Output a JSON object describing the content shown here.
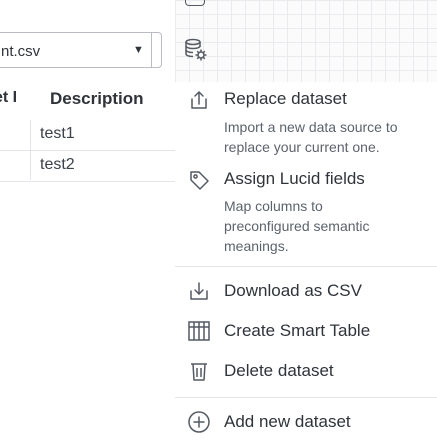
{
  "dataset_select": {
    "value": "nt.csv",
    "caret": "▼"
  },
  "table": {
    "partial_header": "et I",
    "description_header": "Description",
    "rows": [
      "test1",
      "test2"
    ]
  },
  "toolbar": {
    "icons": [
      "layout-icon",
      "database-settings-icon"
    ]
  },
  "menu": {
    "replace": {
      "label": "Replace dataset",
      "description": "Import a new data source to replace your current one.",
      "icon": "upload-icon"
    },
    "assign": {
      "label": "Assign Lucid fields",
      "description": "Map columns to preconfigured semantic meanings.",
      "icon": "tag-icon"
    },
    "download": {
      "label": "Download as CSV",
      "icon": "download-icon"
    },
    "smart_table": {
      "label": "Create Smart Table",
      "icon": "table-icon"
    },
    "delete": {
      "label": "Delete dataset",
      "icon": "trash-icon"
    },
    "add": {
      "label": "Add new dataset",
      "icon": "plus-circle-icon"
    }
  },
  "colors": {
    "text": "#2f343a",
    "muted": "#5c636c",
    "border": "#e3e5e8"
  }
}
